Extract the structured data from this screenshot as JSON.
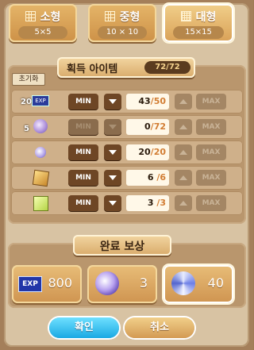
{
  "tabs": [
    {
      "label": "소형",
      "size": "5×5",
      "active": false
    },
    {
      "label": "중형",
      "size": "10 × 10",
      "active": false
    },
    {
      "label": "대형",
      "size": "15×15",
      "active": true
    }
  ],
  "acquired": {
    "title": "획득 아이템",
    "count": "72/72",
    "reset_label": "초기화",
    "min_label": "MIN",
    "max_label": "MAX",
    "items": [
      {
        "icon": "exp-icon",
        "badge": "20",
        "value": "43",
        "max": "/50"
      },
      {
        "icon": "sealed-orb-icon",
        "badge": "5",
        "value": "0",
        "max": "/72"
      },
      {
        "icon": "small-orb-icon",
        "badge": "",
        "value": "20",
        "max": "/20"
      },
      {
        "icon": "gold-box-icon",
        "badge": "",
        "value": "6",
        "max": "/6"
      },
      {
        "icon": "green-cube-icon",
        "badge": "",
        "value": "3",
        "max": "/3"
      }
    ]
  },
  "reward": {
    "title": "완료 보상",
    "items": [
      {
        "icon": "exp-icon",
        "label": "EXP",
        "value": "800"
      },
      {
        "icon": "purple-orb-icon",
        "value": "3"
      },
      {
        "icon": "blue-swirl-icon",
        "value": "40"
      }
    ]
  },
  "actions": {
    "confirm": "확인",
    "cancel": "취소"
  }
}
